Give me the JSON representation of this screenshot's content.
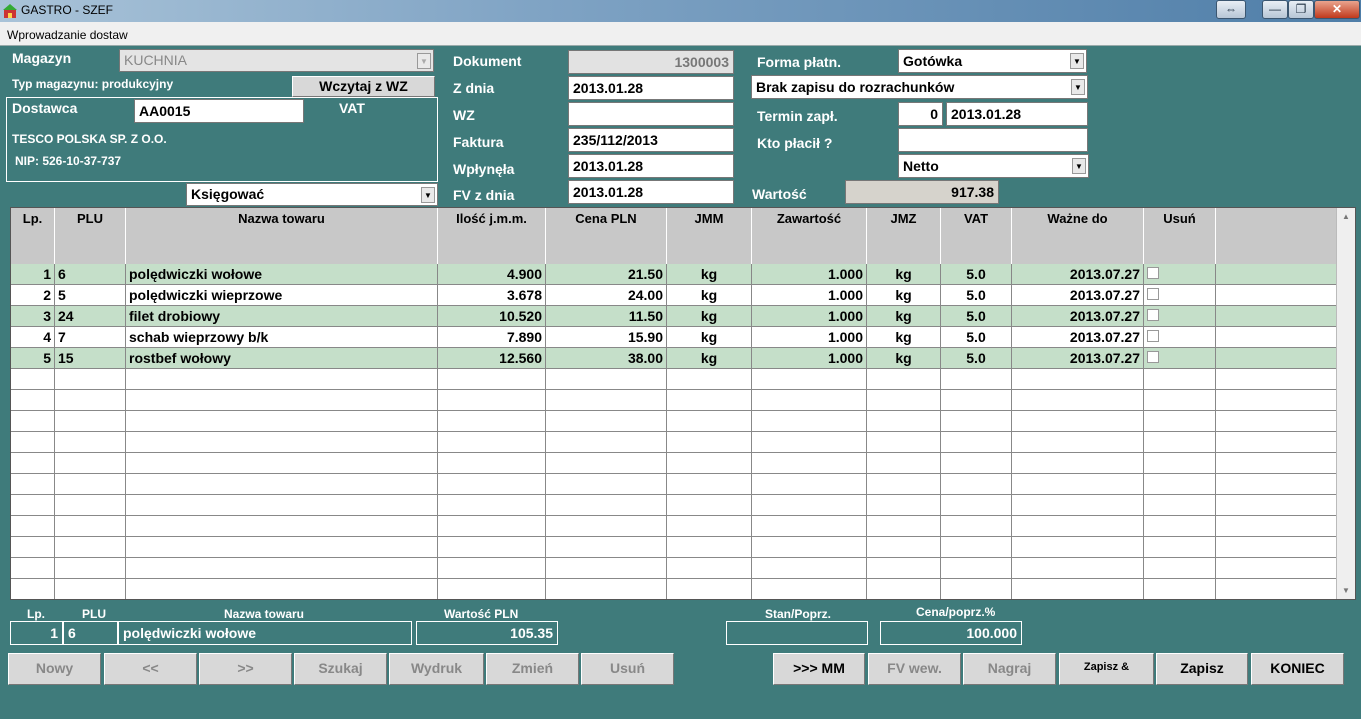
{
  "window": {
    "title": "GASTRO - SZEF",
    "subtitle": "Wprowadzanie dostaw",
    "btn_extra": "⇔",
    "btn_min": "—",
    "btn_max": "❐",
    "btn_close": "✕"
  },
  "magazyn": {
    "label": "Magazyn",
    "value": "KUCHNIA",
    "typ_label": "Typ magazynu: produkcyjny",
    "load_button": "Wczytaj z WZ"
  },
  "dostawca": {
    "label": "Dostawca",
    "code": "AA0015",
    "vat_label": "VAT",
    "name": "TESCO POLSKA SP. Z O.O.",
    "nip": "NIP: 526-10-37-737",
    "ksiegowac": "Księgować"
  },
  "doc": {
    "dokument_label": "Dokument",
    "dokument": "1300003",
    "zdnia_label": "Z dnia",
    "zdnia": "2013.01.28",
    "wz_label": "WZ",
    "wz": "",
    "faktura_label": "Faktura",
    "faktura": "235/112/2013",
    "wplynela_label": "Wpłynęła",
    "wplynela": "2013.01.28",
    "fvzdnia_label": "FV z dnia",
    "fvzdnia": "2013.01.28"
  },
  "pay": {
    "forma_label": "Forma płatn.",
    "forma": "Gotówka",
    "rozrach": "Brak zapisu do rozrachunków",
    "termin_label": "Termin zapł.",
    "termin_days": "0",
    "termin_date": "2013.01.28",
    "kto_label": "Kto płacił ?",
    "kto": "",
    "netto": "Netto",
    "wartosc_label": "Wartość",
    "wartosc": "917.38"
  },
  "table": {
    "headers": [
      "Lp.",
      "PLU",
      "Nazwa towaru",
      "Ilość j.m.m.",
      "Cena PLN",
      "JMM",
      "Zawartość",
      "JMZ",
      "VAT",
      "Ważne do",
      "Usuń"
    ],
    "rows": [
      [
        "1",
        "6",
        "polędwiczki wołowe",
        "4.900",
        "21.50",
        "kg",
        "1.000",
        "kg",
        "5.0",
        "2013.07.27"
      ],
      [
        "2",
        "5",
        "polędwiczki wieprzowe",
        "3.678",
        "24.00",
        "kg",
        "1.000",
        "kg",
        "5.0",
        "2013.07.27"
      ],
      [
        "3",
        "24",
        "filet drobiowy",
        "10.520",
        "11.50",
        "kg",
        "1.000",
        "kg",
        "5.0",
        "2013.07.27"
      ],
      [
        "4",
        "7",
        "schab wieprzowy b/k",
        "7.890",
        "15.90",
        "kg",
        "1.000",
        "kg",
        "5.0",
        "2013.07.27"
      ],
      [
        "5",
        "15",
        "rostbef wołowy",
        "12.560",
        "38.00",
        "kg",
        "1.000",
        "kg",
        "5.0",
        "2013.07.27"
      ]
    ],
    "empty_rows": 11
  },
  "summary": {
    "lp_label": "Lp.",
    "plu_label": "PLU",
    "nazwa_label": "Nazwa towaru",
    "wartosc_label": "Wartość PLN",
    "stan_label": "Stan/Poprz.",
    "cena_label": "Cena/poprz.%",
    "lp": "1",
    "plu": "6",
    "nazwa": "polędwiczki wołowe",
    "wartosc": "105.35",
    "stan": "",
    "cena": "100.000"
  },
  "buttons": {
    "nowy": "Nowy",
    "prev": "<<",
    "next": ">>",
    "szukaj": "Szukaj",
    "wydruk": "Wydruk",
    "zmien": "Zmień",
    "usun": "Usuń",
    "mm": ">>> MM",
    "fvwew": "FV wew.",
    "nagraj": "Nagraj",
    "zapisz_and": "Zapisz &",
    "zapisz": "Zapisz",
    "koniec": "KONIEC"
  }
}
